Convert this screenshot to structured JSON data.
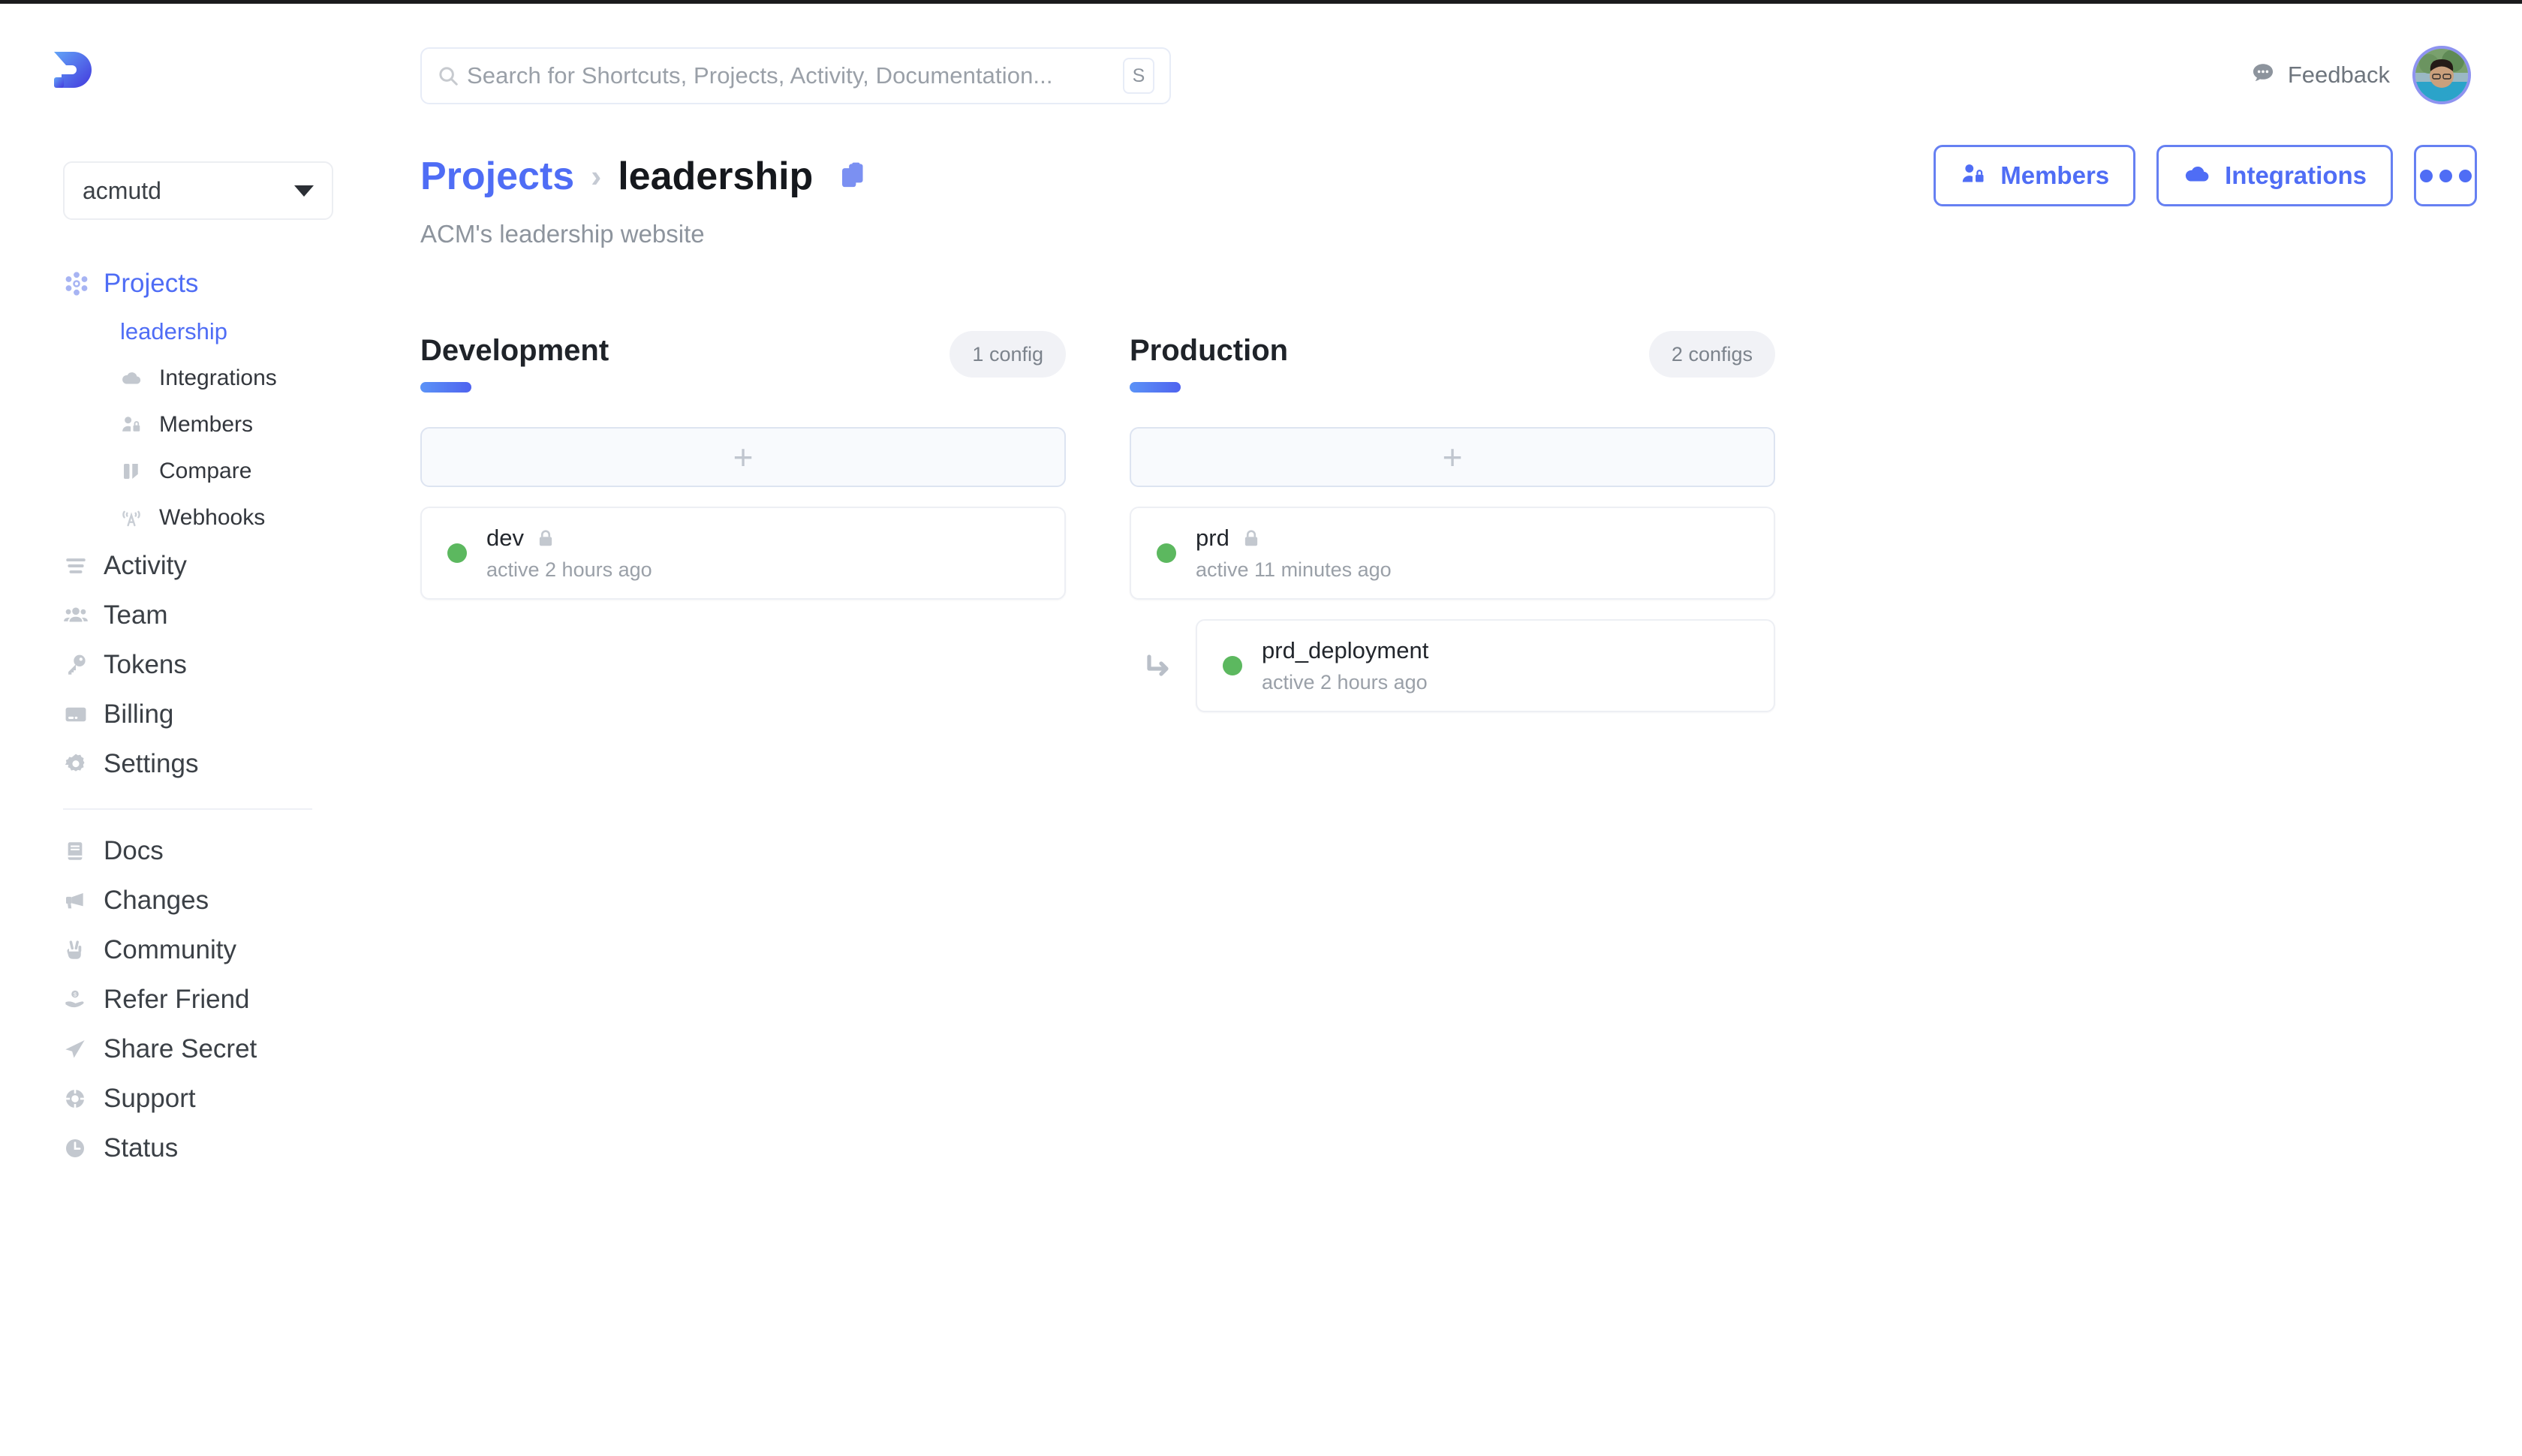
{
  "brand": {
    "name": "Doppler",
    "logo_icon": "doppler-d-logo",
    "accent": "#4f6df5"
  },
  "header": {
    "search": {
      "placeholder": "Search for Shortcuts, Projects, Activity, Documentation...",
      "value": "",
      "shortcut_key": "S",
      "icon": "search-icon"
    },
    "feedback": {
      "label": "Feedback",
      "icon": "chat-bubble-icon"
    },
    "avatar": {
      "icon": "user-avatar"
    }
  },
  "sidebar": {
    "org": {
      "label": "acmutd",
      "icon": "chevron-down-icon"
    },
    "projects": {
      "label": "Projects",
      "icon": "atom-icon"
    },
    "current_project": {
      "label": "leadership"
    },
    "project_sub_items": [
      {
        "label": "Integrations",
        "icon": "cloud-icon"
      },
      {
        "label": "Members",
        "icon": "user-lock-icon"
      },
      {
        "label": "Compare",
        "icon": "compare-icon"
      },
      {
        "label": "Webhooks",
        "icon": "broadcast-icon"
      }
    ],
    "main_items": [
      {
        "label": "Activity",
        "icon": "list-icon"
      },
      {
        "label": "Team",
        "icon": "people-icon"
      },
      {
        "label": "Tokens",
        "icon": "key-icon"
      },
      {
        "label": "Billing",
        "icon": "credit-card-icon"
      },
      {
        "label": "Settings",
        "icon": "gear-icon"
      }
    ],
    "footer_items": [
      {
        "label": "Docs",
        "icon": "book-icon"
      },
      {
        "label": "Changes",
        "icon": "megaphone-icon"
      },
      {
        "label": "Community",
        "icon": "hand-peace-icon"
      },
      {
        "label": "Refer Friend",
        "icon": "hand-dollar-icon"
      },
      {
        "label": "Share Secret",
        "icon": "paper-plane-icon"
      },
      {
        "label": "Support",
        "icon": "lifebuoy-icon"
      },
      {
        "label": "Status",
        "icon": "clock-icon"
      }
    ]
  },
  "main": {
    "breadcrumb": {
      "root": "Projects",
      "separator": "›",
      "leaf": "leadership",
      "copy_icon": "copy-icon"
    },
    "subtitle": "ACM's leadership website",
    "actions": [
      {
        "label": "Members",
        "icon": "user-lock-icon"
      },
      {
        "label": "Integrations",
        "icon": "cloud-icon"
      }
    ],
    "more_button": {
      "icon": "ellipsis-icon"
    },
    "environments": [
      {
        "name": "Development",
        "config_count_label": "1 config",
        "add_label": "+",
        "configs": [
          {
            "name": "dev",
            "status": "active",
            "status_color": "#5cb85f",
            "activity": "active 2 hours ago",
            "locked": true,
            "nested": false
          }
        ]
      },
      {
        "name": "Production",
        "config_count_label": "2 configs",
        "add_label": "+",
        "configs": [
          {
            "name": "prd",
            "status": "active",
            "status_color": "#5cb85f",
            "activity": "active 11 minutes ago",
            "locked": true,
            "nested": false
          },
          {
            "name": "prd_deployment",
            "status": "active",
            "status_color": "#5cb85f",
            "activity": "active 2 hours ago",
            "locked": false,
            "nested": true
          }
        ]
      }
    ]
  }
}
